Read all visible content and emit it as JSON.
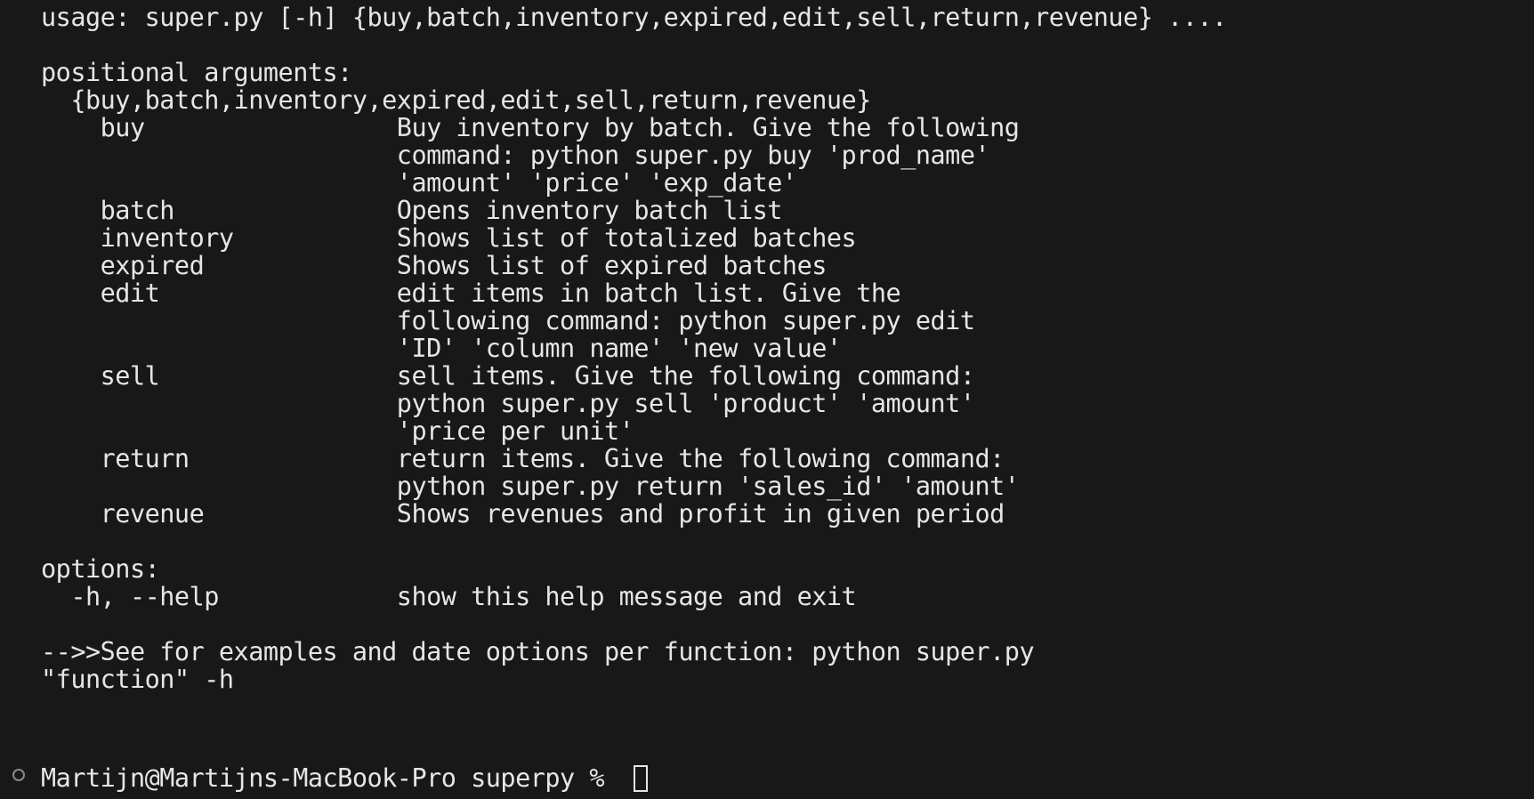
{
  "terminal": {
    "usage": "usage: super.py [-h] {buy,batch,inventory,expired,edit,sell,return,revenue} ....",
    "positional_header": "positional arguments:",
    "choices": "  {buy,batch,inventory,expired,edit,sell,return,revenue}",
    "commands": [
      "    buy                 Buy inventory by batch. Give the following",
      "                        command: python super.py buy 'prod_name'",
      "                        'amount' 'price' 'exp_date'",
      "    batch               Opens inventory batch list",
      "    inventory           Shows list of totalized batches",
      "    expired             Shows list of expired batches",
      "    edit                edit items in batch list. Give the",
      "                        following command: python super.py edit",
      "                        'ID' 'column name' 'new value'",
      "    sell                sell items. Give the following command:",
      "                        python super.py sell 'product' 'amount'",
      "                        'price per unit'",
      "    return              return items. Give the following command:",
      "                        python super.py return 'sales_id' 'amount'",
      "    revenue             Shows revenues and profit in given period"
    ],
    "options_header": "options:",
    "help_option": "  -h, --help            show this help message and exit",
    "epilog_1": "-->>See for examples and date options per function: python super.py",
    "epilog_2": "\"function\" -h",
    "prompt": "Martijn@Martijns-MacBook-Pro superpy % "
  }
}
